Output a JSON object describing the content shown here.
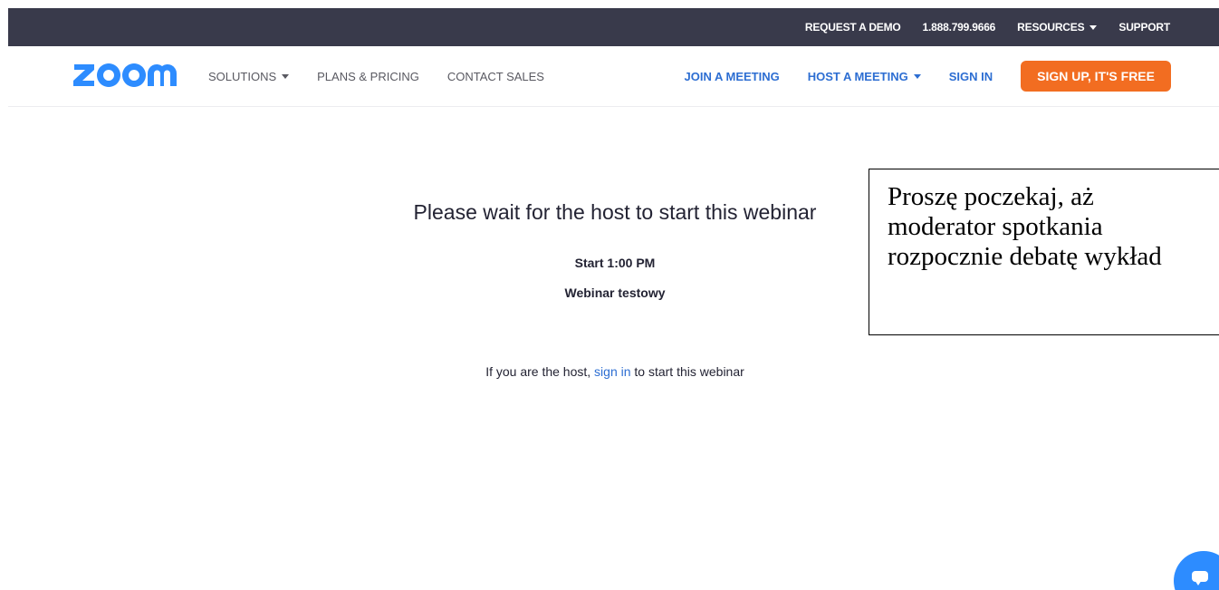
{
  "topbar": {
    "request_demo": "REQUEST A DEMO",
    "phone": "1.888.799.9666",
    "resources": "RESOURCES",
    "support": "SUPPORT"
  },
  "nav": {
    "logo_text": "zoom",
    "solutions": "SOLUTIONS",
    "plans_pricing": "PLANS & PRICING",
    "contact_sales": "CONTACT SALES",
    "join_meeting": "JOIN A MEETING",
    "host_meeting": "HOST A MEETING",
    "sign_in": "SIGN IN",
    "sign_up": "SIGN UP, IT'S FREE"
  },
  "main": {
    "title": "Please wait for the host to start this webinar",
    "start_time": "Start 1:00 PM",
    "webinar_name": "Webinar testowy",
    "host_prefix": "If you are the host,",
    "host_link": "sign in",
    "host_suffix": "to start this webinar"
  },
  "annotation": {
    "text": "Proszę poczekaj, aż moderator spotkania rozpocznie debatę wykład"
  },
  "colors": {
    "topbar_bg": "#393a4b",
    "brand_blue": "#2d8cff",
    "link_blue": "#2d6ed2",
    "signup_orange": "#f26d21"
  },
  "icons": {
    "chat": "chat-bubble-icon"
  }
}
